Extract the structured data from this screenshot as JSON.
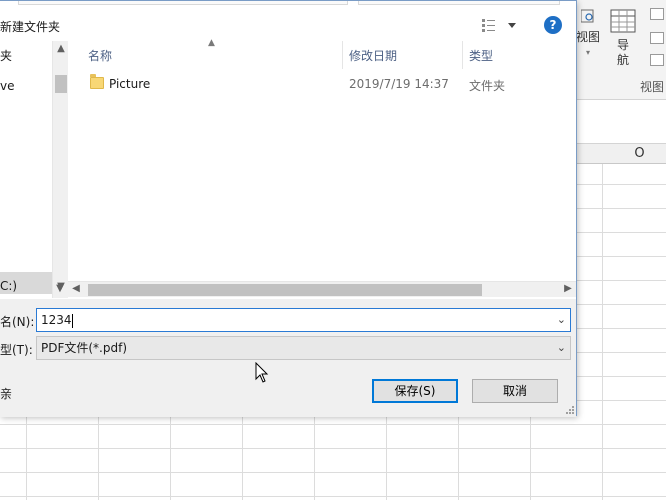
{
  "background_app": {
    "ribbon": {
      "btn_view_label": "视图",
      "btn_nav_label_1": "导",
      "btn_nav_label_2": "航",
      "group_label": "视图"
    },
    "column_headers": [
      "O"
    ]
  },
  "dialog": {
    "toolbar": {
      "new_folder_label": "新建文件夹",
      "view_icon": "view-options-icon",
      "help_label": "?"
    },
    "nav_pane": {
      "items": [
        "夹",
        "ve",
        "C:)"
      ]
    },
    "file_list": {
      "columns": [
        "名称",
        "修改日期",
        "类型"
      ],
      "rows": [
        {
          "name": "Picture",
          "modified": "2019/7/19 14:37",
          "type": "文件夹"
        }
      ]
    },
    "filename": {
      "label": "名(N):",
      "value": "1234"
    },
    "filetype": {
      "label": "型(T):",
      "value": "PDF文件(*.pdf)"
    },
    "side_label": "亲",
    "buttons": {
      "save": "保存(S)",
      "cancel": "取消"
    }
  },
  "colors": {
    "accent": "#0078d7",
    "help": "#1e6fc5",
    "folder": "#f8d775"
  }
}
